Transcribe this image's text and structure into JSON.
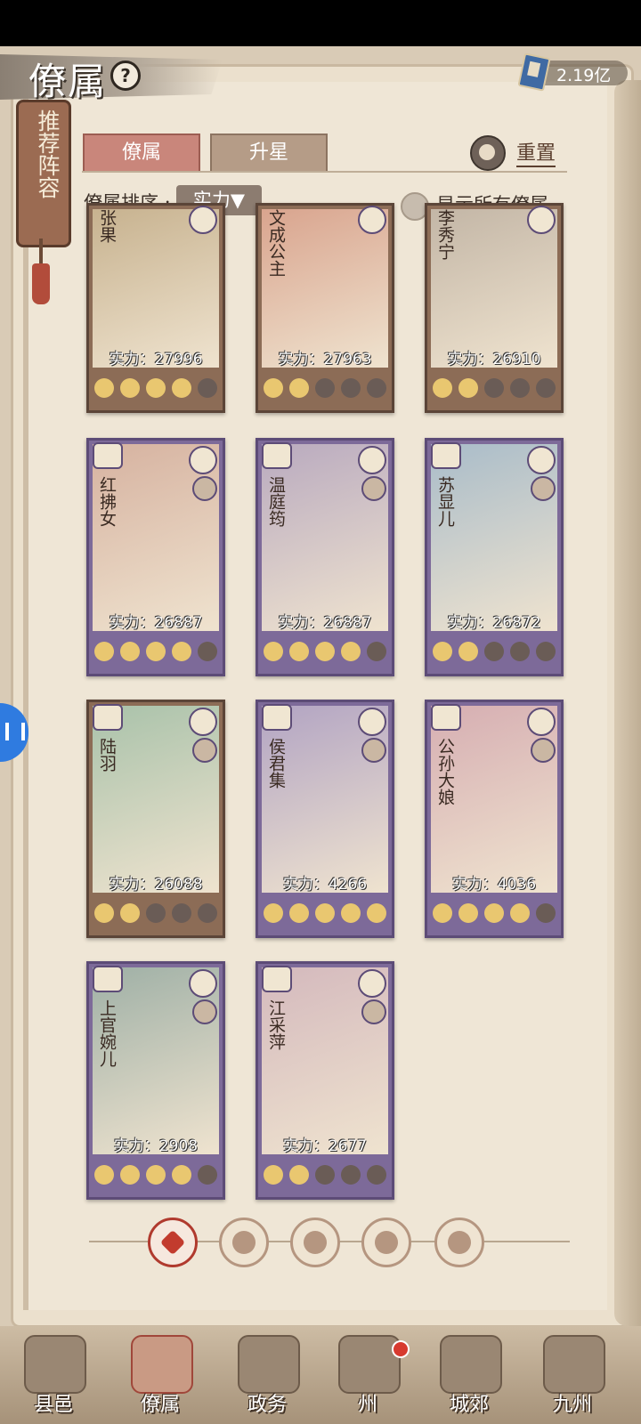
{
  "header": {
    "title": "僚属",
    "currency": "2.19亿"
  },
  "side_tag": {
    "label": "推荐阵容"
  },
  "tabs": [
    {
      "label": "僚属",
      "active": true
    },
    {
      "label": "升星",
      "active": false
    }
  ],
  "reset_label": "重置",
  "sort": {
    "label": "僚属排序 :",
    "value": "实力▼"
  },
  "show_all": "显示所有僚属",
  "cards": [
    {
      "name": "张果",
      "power": "实力：27996",
      "stars": 4,
      "frame": "brown",
      "color": "#c7b28f"
    },
    {
      "name": "文成公主",
      "power": "实力：27963",
      "stars": 2,
      "frame": "brown",
      "color": "#d9a48e"
    },
    {
      "name": "李秀宁",
      "power": "实力：26910",
      "stars": 2,
      "frame": "brown",
      "color": "#c3b6a6"
    },
    {
      "name": "红拂女",
      "power": "实力：26887",
      "stars": 4,
      "frame": "purple",
      "color": "#d6b2a0"
    },
    {
      "name": "温庭筠",
      "power": "实力：26887",
      "stars": 4,
      "frame": "purple",
      "color": "#b9aabf"
    },
    {
      "name": "苏显儿",
      "power": "实力：26872",
      "stars": 2,
      "frame": "purple",
      "color": "#a9bcc9"
    },
    {
      "name": "陆羽",
      "power": "实力：26088",
      "stars": 2,
      "frame": "brown",
      "color": "#a9c2aa"
    },
    {
      "name": "侯君集",
      "power": "实力：4266",
      "stars": 5,
      "frame": "purple",
      "color": "#b2a4c3"
    },
    {
      "name": "公孙大娘",
      "power": "实力：4036",
      "stars": 4,
      "frame": "purple",
      "color": "#d6aeb2"
    },
    {
      "name": "上官婉儿",
      "power": "实力：2908",
      "stars": 4,
      "frame": "purple",
      "color": "#9fb0a6"
    },
    {
      "name": "江采萍",
      "power": "实力：2677",
      "stars": 2,
      "frame": "purple",
      "color": "#d4b9bd"
    }
  ],
  "filter_icons": [
    "all-filter-icon",
    "role-filter-icon-1",
    "role-filter-icon-2",
    "role-filter-icon-3",
    "role-filter-icon-4"
  ],
  "bottom_nav": [
    {
      "label": "县邑",
      "active": false
    },
    {
      "label": "僚属",
      "active": true
    },
    {
      "label": "政务",
      "active": false
    },
    {
      "label": "州",
      "active": false
    },
    {
      "label": "城郊",
      "active": false
    },
    {
      "label": "九州",
      "active": false
    }
  ]
}
